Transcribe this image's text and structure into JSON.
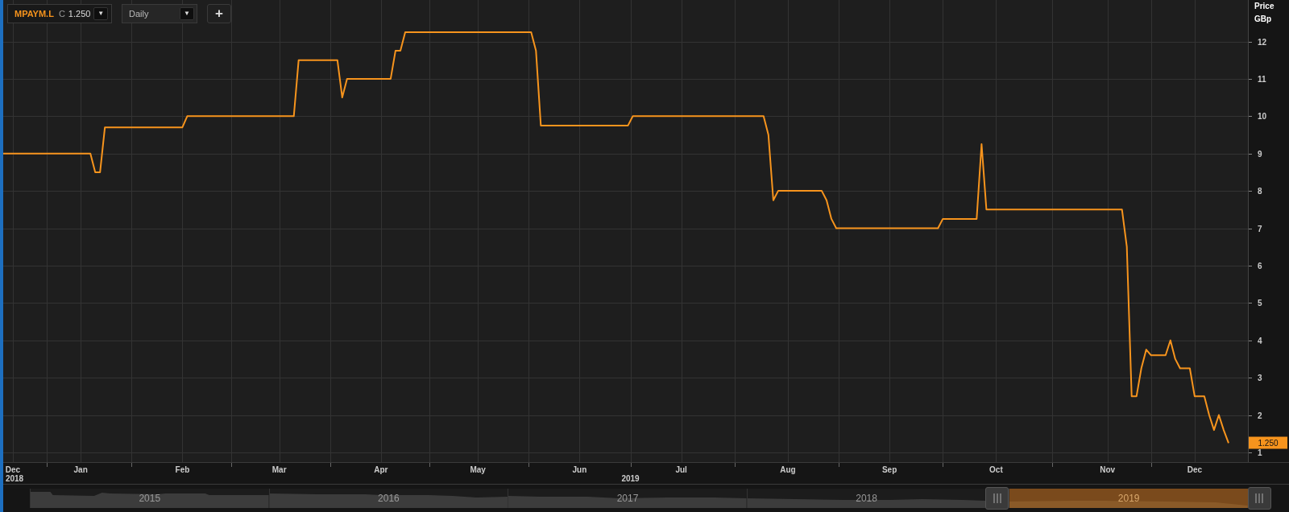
{
  "toolbar": {
    "symbol": "MPAYM.L",
    "price_label": "C",
    "price": "1.250",
    "symbol_menu": "▼",
    "interval": "Daily",
    "interval_menu": "▼",
    "add_button": "+"
  },
  "chart": {
    "last_price": "1.250",
    "year_labels": [
      "2018",
      "2019"
    ],
    "chart_data": {
      "type": "line",
      "ylabel": "Price GBp",
      "categories": [
        null,
        null,
        "Dec",
        null,
        null,
        null,
        null,
        null,
        null,
        null,
        null,
        null,
        null,
        null,
        null,
        null,
        "Jan",
        null,
        null,
        null,
        null,
        null,
        null,
        null,
        null,
        null,
        null,
        null,
        null,
        null,
        null,
        null,
        null,
        null,
        null,
        null,
        null,
        "Feb",
        null,
        null,
        null,
        null,
        null,
        null,
        null,
        null,
        null,
        null,
        null,
        null,
        null,
        null,
        null,
        null,
        null,
        null,
        null,
        "Mar",
        null,
        null,
        null,
        null,
        null,
        null,
        null,
        null,
        null,
        null,
        null,
        null,
        null,
        null,
        null,
        null,
        null,
        null,
        null,
        null,
        "Apr",
        null,
        null,
        null,
        null,
        null,
        null,
        null,
        null,
        null,
        null,
        null,
        null,
        null,
        null,
        null,
        null,
        null,
        null,
        null,
        "May",
        null,
        null,
        null,
        null,
        null,
        null,
        null,
        null,
        null,
        null,
        null,
        null,
        null,
        null,
        null,
        null,
        null,
        null,
        null,
        null,
        "Jun",
        null,
        null,
        null,
        null,
        null,
        null,
        null,
        null,
        null,
        null,
        null,
        null,
        null,
        null,
        null,
        null,
        null,
        null,
        null,
        null,
        "Jul",
        null,
        null,
        null,
        null,
        null,
        null,
        null,
        null,
        null,
        null,
        null,
        null,
        null,
        null,
        null,
        null,
        null,
        null,
        null,
        null,
        null,
        "Aug",
        null,
        null,
        null,
        null,
        null,
        null,
        null,
        null,
        null,
        null,
        null,
        null,
        null,
        null,
        null,
        null,
        null,
        null,
        null,
        null,
        "Sep",
        null,
        null,
        null,
        null,
        null,
        null,
        null,
        null,
        null,
        null,
        null,
        null,
        null,
        null,
        null,
        null,
        null,
        null,
        null,
        null,
        null,
        "Oct",
        null,
        null,
        null,
        null,
        null,
        null,
        null,
        null,
        null,
        null,
        null,
        null,
        null,
        null,
        null,
        null,
        null,
        null,
        null,
        null,
        null,
        null,
        "Nov",
        null,
        null,
        null,
        null,
        null,
        null,
        null,
        null,
        null,
        null,
        null,
        null,
        null,
        null,
        null,
        null,
        null,
        "Dec",
        null,
        null,
        null,
        null,
        null,
        null,
        null
      ],
      "series": [
        {
          "color": "#f7941d",
          "values": [
            9,
            9,
            9,
            9,
            9,
            9,
            9,
            9,
            9,
            9,
            9,
            9,
            9,
            9,
            9,
            9,
            9,
            9,
            9,
            8.5,
            8.5,
            9.7,
            9.7,
            9.7,
            9.7,
            9.7,
            9.7,
            9.7,
            9.7,
            9.7,
            9.7,
            9.7,
            9.7,
            9.7,
            9.7,
            9.7,
            9.7,
            9.7,
            10,
            10,
            10,
            10,
            10,
            10,
            10,
            10,
            10,
            10,
            10,
            10,
            10,
            10,
            10,
            10,
            10,
            10,
            10,
            10,
            10,
            10,
            10,
            11.5,
            11.5,
            11.5,
            11.5,
            11.5,
            11.5,
            11.5,
            11.5,
            11.5,
            10.5,
            11,
            11,
            11,
            11,
            11,
            11,
            11,
            11,
            11,
            11,
            11.75,
            11.75,
            12.25,
            12.25,
            12.25,
            12.25,
            12.25,
            12.25,
            12.25,
            12.25,
            12.25,
            12.25,
            12.25,
            12.25,
            12.25,
            12.25,
            12.25,
            12.25,
            12.25,
            12.25,
            12.25,
            12.25,
            12.25,
            12.25,
            12.25,
            12.25,
            12.25,
            12.25,
            12.25,
            11.75,
            9.75,
            9.75,
            9.75,
            9.75,
            9.75,
            9.75,
            9.75,
            9.75,
            9.75,
            9.75,
            9.75,
            9.75,
            9.75,
            9.75,
            9.75,
            9.75,
            9.75,
            9.75,
            9.75,
            10,
            10,
            10,
            10,
            10,
            10,
            10,
            10,
            10,
            10,
            10,
            10,
            10,
            10,
            10,
            10,
            10,
            10,
            10,
            10,
            10,
            10,
            10,
            10,
            10,
            10,
            10,
            10,
            9.5,
            7.75,
            8,
            8,
            8,
            8,
            8,
            8,
            8,
            8,
            8,
            8,
            7.75,
            7.25,
            7,
            7,
            7,
            7,
            7,
            7,
            7,
            7,
            7,
            7,
            7,
            7,
            7,
            7,
            7,
            7,
            7,
            7,
            7,
            7,
            7,
            7,
            7.25,
            7.25,
            7.25,
            7.25,
            7.25,
            7.25,
            7.25,
            7.25,
            9.25,
            7.5,
            7.5,
            7.5,
            7.5,
            7.5,
            7.5,
            7.5,
            7.5,
            7.5,
            7.5,
            7.5,
            7.5,
            7.5,
            7.5,
            7.5,
            7.5,
            7.5,
            7.5,
            7.5,
            7.5,
            7.5,
            7.5,
            7.5,
            7.5,
            7.5,
            7.5,
            7.5,
            7.5,
            7.5,
            6.5,
            2.5,
            2.5,
            3.25,
            3.75,
            3.6,
            3.6,
            3.6,
            3.6,
            4,
            3.5,
            3.25,
            3.25,
            3.25,
            2.5,
            2.5,
            2.5,
            2,
            1.6,
            2,
            1.6,
            1.25
          ]
        }
      ],
      "ylim": [
        0.74,
        13.11
      ],
      "grid": true,
      "yticks": [
        1,
        2,
        3,
        4,
        5,
        6,
        7,
        8,
        9,
        10,
        11,
        12
      ]
    }
  },
  "navigator": {
    "years": [
      {
        "label": "2015",
        "selected": false
      },
      {
        "label": "2016",
        "selected": false
      },
      {
        "label": "2017",
        "selected": false
      },
      {
        "label": "2018",
        "selected": false
      },
      {
        "label": "2019",
        "selected": true
      }
    ]
  }
}
